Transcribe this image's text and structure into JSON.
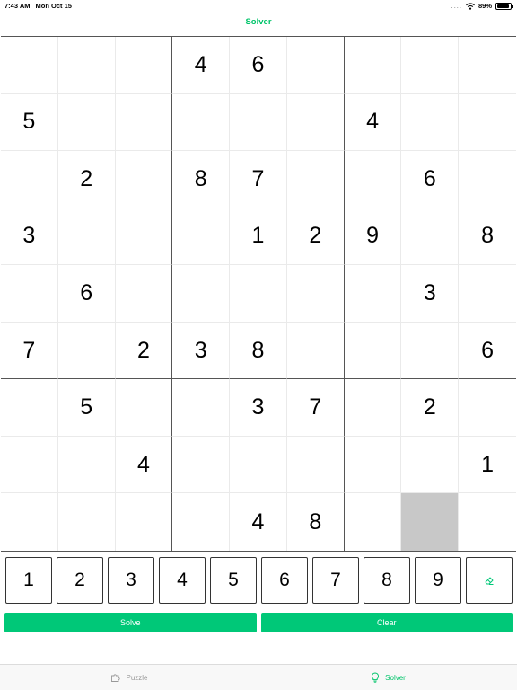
{
  "status_bar": {
    "time": "7:43 AM",
    "date": "Mon Oct 15",
    "dots": "....",
    "battery": "89%"
  },
  "nav": {
    "title": "Solver"
  },
  "grid": {
    "rows": [
      [
        "",
        "",
        "",
        "4",
        "6",
        "",
        "",
        "",
        ""
      ],
      [
        "5",
        "",
        "",
        "",
        "",
        "",
        "4",
        "",
        ""
      ],
      [
        "",
        "2",
        "",
        "8",
        "7",
        "",
        "",
        "6",
        ""
      ],
      [
        "3",
        "",
        "",
        "",
        "1",
        "2",
        "9",
        "",
        "8"
      ],
      [
        "",
        "6",
        "",
        "",
        "",
        "",
        "",
        "3",
        ""
      ],
      [
        "7",
        "",
        "2",
        "3",
        "8",
        "",
        "",
        "",
        "6"
      ],
      [
        "",
        "5",
        "",
        "",
        "3",
        "7",
        "",
        "2",
        ""
      ],
      [
        "",
        "",
        "4",
        "",
        "",
        "",
        "",
        "",
        "1"
      ],
      [
        "",
        "",
        "",
        "",
        "4",
        "8",
        "",
        "",
        ""
      ]
    ],
    "selected": {
      "row": 8,
      "col": 7
    }
  },
  "numpad": {
    "keys": [
      "1",
      "2",
      "3",
      "4",
      "5",
      "6",
      "7",
      "8",
      "9"
    ],
    "erase_icon": "eraser-icon"
  },
  "actions": {
    "solve_label": "Solve",
    "clear_label": "Clear"
  },
  "tabs": [
    {
      "label": "Puzzle",
      "icon": "puzzle-icon",
      "active": false
    },
    {
      "label": "Solver",
      "icon": "lightbulb-icon",
      "active": true
    }
  ],
  "colors": {
    "accent": "#00c878",
    "selected_cell": "#c8c8c8"
  }
}
